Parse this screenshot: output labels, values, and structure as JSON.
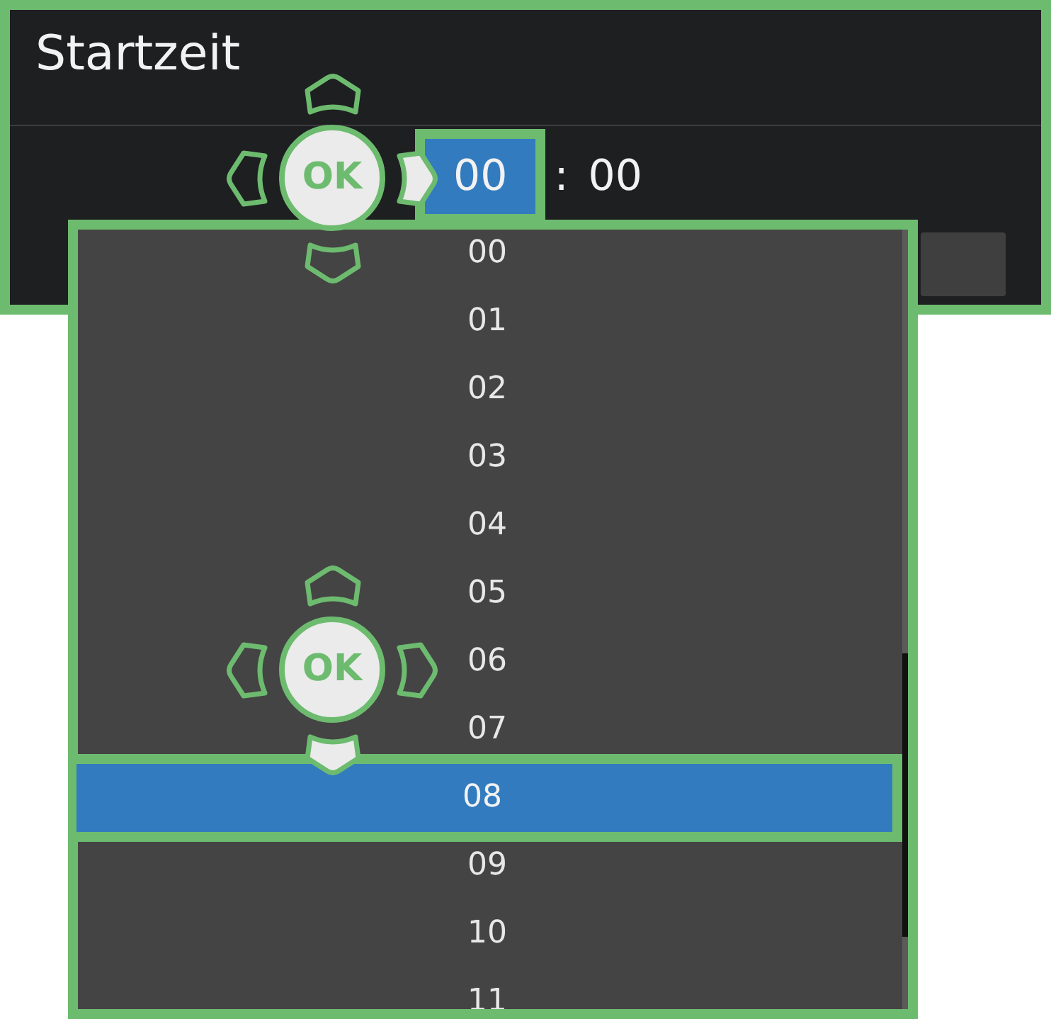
{
  "dialog": {
    "title": "Startzeit",
    "highlighted": true,
    "time": {
      "hour": {
        "value": "00",
        "selected": true
      },
      "separator": ":",
      "minute": {
        "value": "00",
        "selected": false
      }
    },
    "remote_hint": {
      "center_label": "OK",
      "up": {
        "pressed": false
      },
      "left": {
        "pressed": false
      },
      "right": {
        "pressed": true
      },
      "down": {
        "pressed": false
      }
    }
  },
  "dropdown": {
    "highlighted": true,
    "items": [
      {
        "label": "00",
        "selected": false
      },
      {
        "label": "01",
        "selected": false
      },
      {
        "label": "02",
        "selected": false
      },
      {
        "label": "03",
        "selected": false
      },
      {
        "label": "04",
        "selected": false
      },
      {
        "label": "05",
        "selected": false
      },
      {
        "label": "06",
        "selected": false
      },
      {
        "label": "07",
        "selected": false
      },
      {
        "label": "08",
        "selected": true
      },
      {
        "label": "09",
        "selected": false
      },
      {
        "label": "10",
        "selected": false
      },
      {
        "label": "11",
        "selected": false
      }
    ],
    "remote_hint": {
      "center_label": "OK",
      "up": {
        "pressed": false
      },
      "left": {
        "pressed": false
      },
      "right": {
        "pressed": false
      },
      "down": {
        "pressed": true
      }
    }
  }
}
